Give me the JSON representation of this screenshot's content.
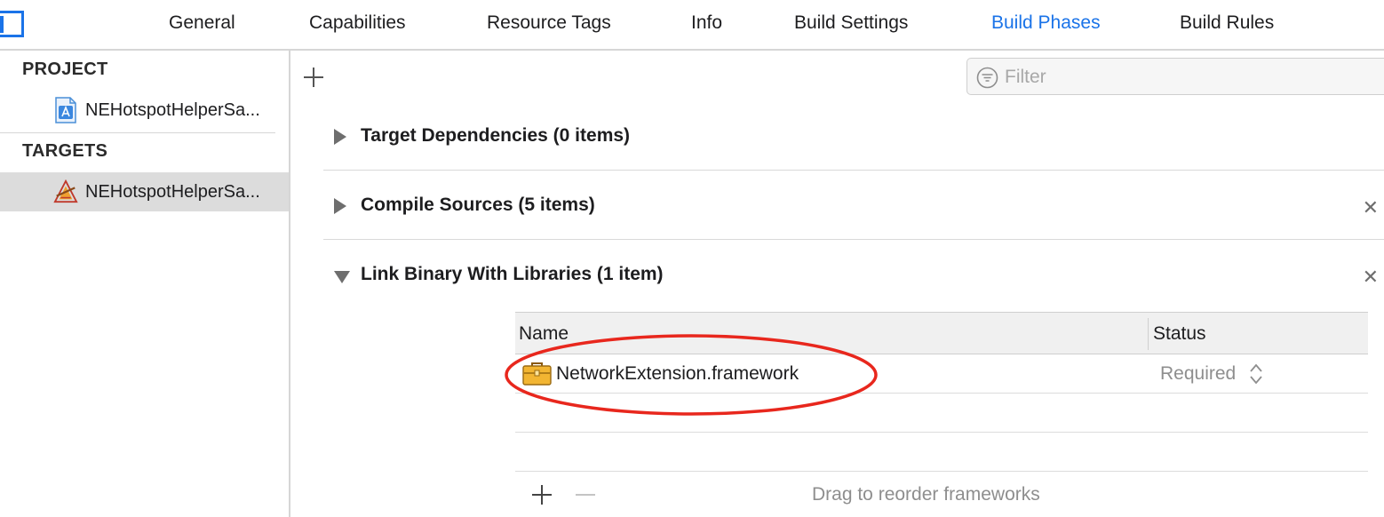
{
  "tabs": [
    {
      "label": "General"
    },
    {
      "label": "Capabilities"
    },
    {
      "label": "Resource Tags"
    },
    {
      "label": "Info"
    },
    {
      "label": "Build Settings"
    },
    {
      "label": "Build Phases"
    },
    {
      "label": "Build Rules"
    }
  ],
  "active_tab": "Build Phases",
  "navigator": {
    "project_header": "PROJECT",
    "project_item": "NEHotspotHelperSa...",
    "targets_header": "TARGETS",
    "target_item": "NEHotspotHelperSa..."
  },
  "filter": {
    "placeholder": "Filter"
  },
  "phases": [
    {
      "title": "Target Dependencies (0 items)",
      "expanded": false,
      "closable": false
    },
    {
      "title": "Compile Sources (5 items)",
      "expanded": false,
      "closable": true
    },
    {
      "title": "Link Binary With Libraries (1 item)",
      "expanded": true,
      "closable": true
    }
  ],
  "close_glyph": "✕",
  "library_table": {
    "col_name": "Name",
    "col_status": "Status",
    "rows": [
      {
        "name": "NetworkExtension.framework",
        "status": "Required"
      }
    ]
  },
  "footer": {
    "hint": "Drag to reorder frameworks"
  },
  "colors": {
    "accent": "#1a73e8",
    "highlight_ellipse": "#e8271d"
  },
  "icons": {
    "sidebar_toggle": "sidebar-toggle-icon",
    "project": "xcode-project-icon",
    "target": "app-target-icon",
    "filter": "filter-icon",
    "framework": "toolbox-icon",
    "stepper": "updown-chevron-icon"
  }
}
